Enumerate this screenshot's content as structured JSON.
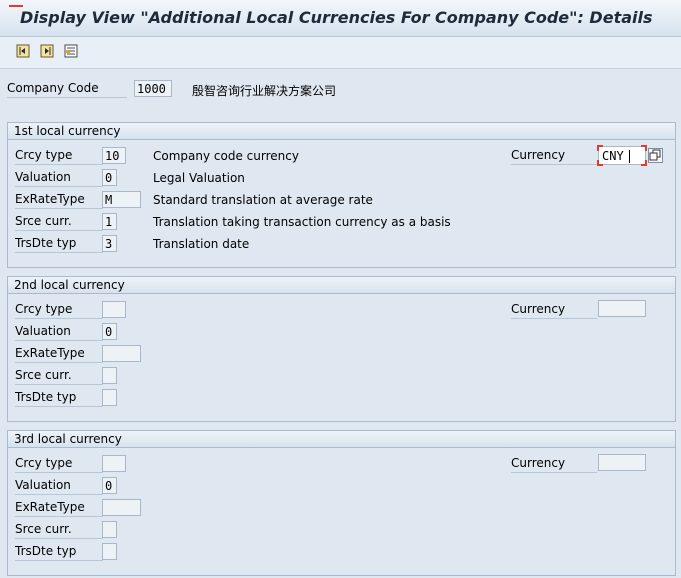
{
  "title": "Display View \"Additional Local Currencies For Company Code\": Details",
  "toolbar": {
    "icons": [
      "previous-entry-icon",
      "next-entry-icon",
      "other-entry-icon"
    ]
  },
  "company": {
    "label": "Company Code",
    "code": "1000",
    "name": "殷智咨询行业解决方案公司"
  },
  "labels": {
    "crcy_type": "Crcy type",
    "valuation": "Valuation",
    "exratetype": "ExRateType",
    "srce_curr": "Srce curr.",
    "trsdte_typ": "TrsDte typ",
    "currency": "Currency"
  },
  "sections": [
    {
      "title": "1st local currency",
      "crcy_type": "10",
      "crcy_type_desc": "Company code currency",
      "valuation": "0",
      "valuation_desc": "Legal Valuation",
      "exratetype": "M",
      "exratetype_desc": "Standard translation at average rate",
      "srce_curr": "1",
      "srce_curr_desc": "Translation taking transaction currency as a basis",
      "trsdte_typ": "3",
      "trsdte_typ_desc": "Translation date",
      "currency": "CNY"
    },
    {
      "title": "2nd local currency",
      "crcy_type": "",
      "valuation": "0",
      "exratetype": "",
      "srce_curr": "",
      "trsdte_typ": "",
      "currency": ""
    },
    {
      "title": "3rd local currency",
      "crcy_type": "",
      "valuation": "0",
      "exratetype": "",
      "srce_curr": "",
      "trsdte_typ": "",
      "currency": ""
    }
  ]
}
